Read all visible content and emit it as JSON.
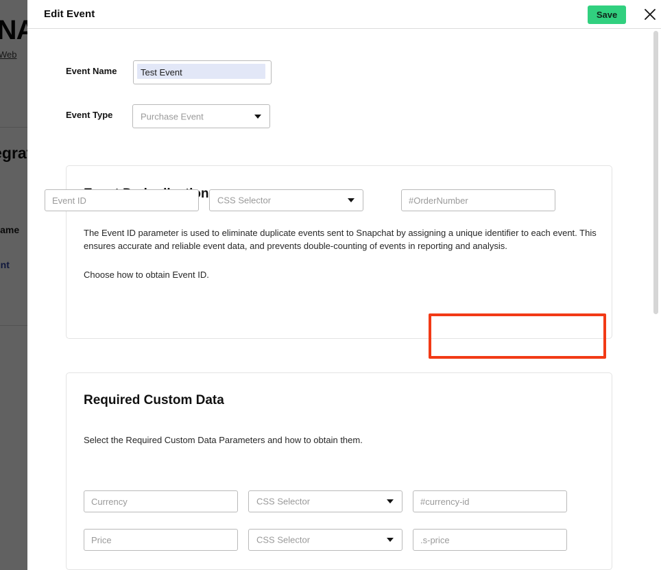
{
  "background_page": {
    "hero_title": "SNAPCHAT",
    "web_link": "Web",
    "section_title": "Integrations",
    "table_column_header": "Name",
    "table_cell_link": "acount"
  },
  "modal": {
    "title": "Edit Event",
    "save_label": "Save",
    "close_icon": "close-icon",
    "scrollbar": {
      "orientation": "vertical"
    }
  },
  "form": {
    "event_name": {
      "label": "Event Name",
      "value": "Test Event",
      "placeholder": "Event Name",
      "selection_highlight": "#e2e7f7"
    },
    "event_type": {
      "label": "Event Type",
      "value": "Purchase Event",
      "caret_icon": "chevron-down-icon"
    }
  },
  "deduplication_card": {
    "title": "Event Deduplication",
    "description": "The Event ID parameter is used to eliminate duplicate events sent to Snapchat by assigning a unique identifier to each event. This ensures accurate and reliable event data, and prevents double-counting of events in reporting and analysis.",
    "instruction": "Choose how to obtain Event ID.",
    "row": {
      "name_placeholder": "Event ID",
      "method_value": "CSS Selector",
      "selector_placeholder": "#OrderNumber"
    }
  },
  "custom_data_card": {
    "title": "Required Custom Data",
    "description": "Select the Required Custom Data Parameters and how to obtain them.",
    "rows": [
      {
        "name_placeholder": "Currency",
        "method_value": "CSS Selector",
        "selector_placeholder": "#currency-id"
      },
      {
        "name_placeholder": "Price",
        "method_value": "CSS Selector",
        "selector_placeholder": ".s-price"
      }
    ]
  },
  "annotation": {
    "name": "highlight-box",
    "color": "#f23a16",
    "target": "#OrderNumber selector field"
  },
  "colors": {
    "save_green": "#31d07f",
    "annotation_red": "#f23a16",
    "selection_blue": "#e2e7f7",
    "scrim": "rgba(0,0,0,0.62)"
  }
}
